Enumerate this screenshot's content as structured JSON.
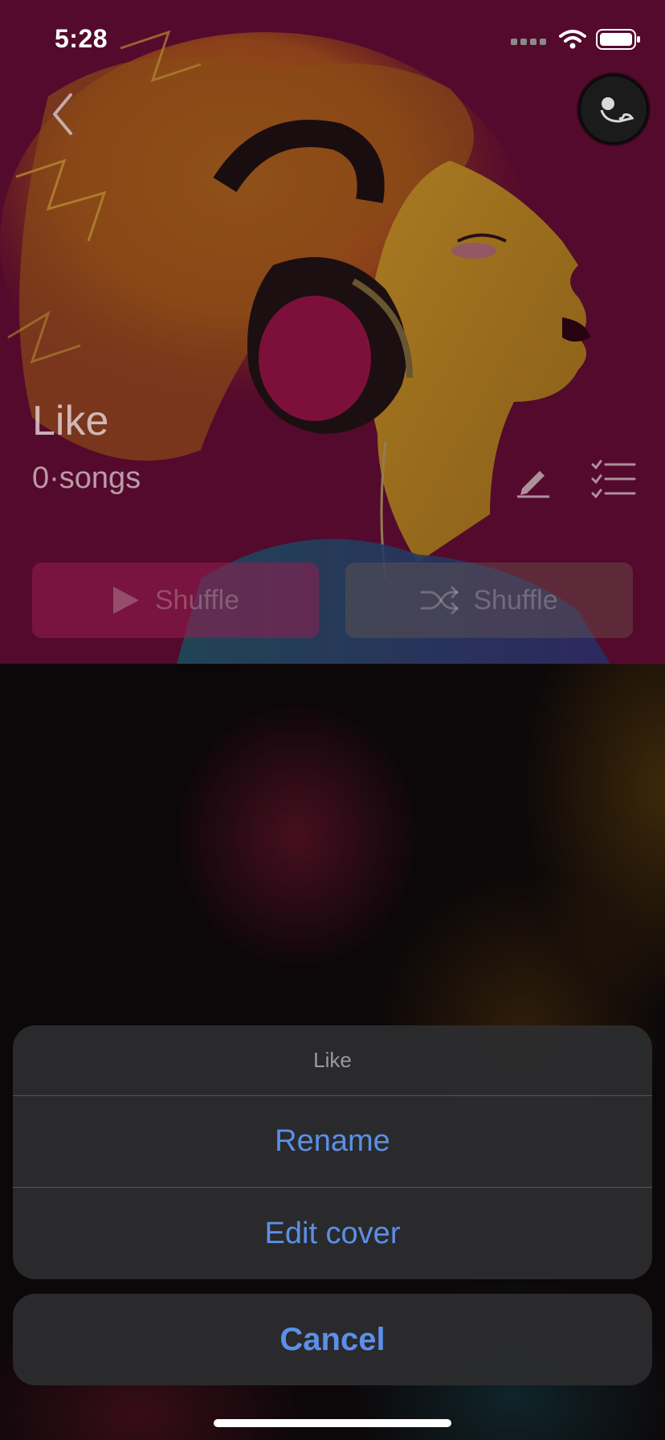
{
  "status_bar": {
    "time": "5:28"
  },
  "playlist": {
    "title": "Like",
    "song_count": "0·songs",
    "play_label": "Shuffle",
    "shuffle_label": "Shuffle"
  },
  "action_sheet": {
    "title": "Like",
    "items": [
      {
        "label": "Rename"
      },
      {
        "label": "Edit cover"
      }
    ],
    "cancel_label": "Cancel"
  },
  "colors": {
    "accent": "#5b8fe8",
    "sheet_bg": "#2c2c2e",
    "hero_bg": "#6a0f36"
  }
}
